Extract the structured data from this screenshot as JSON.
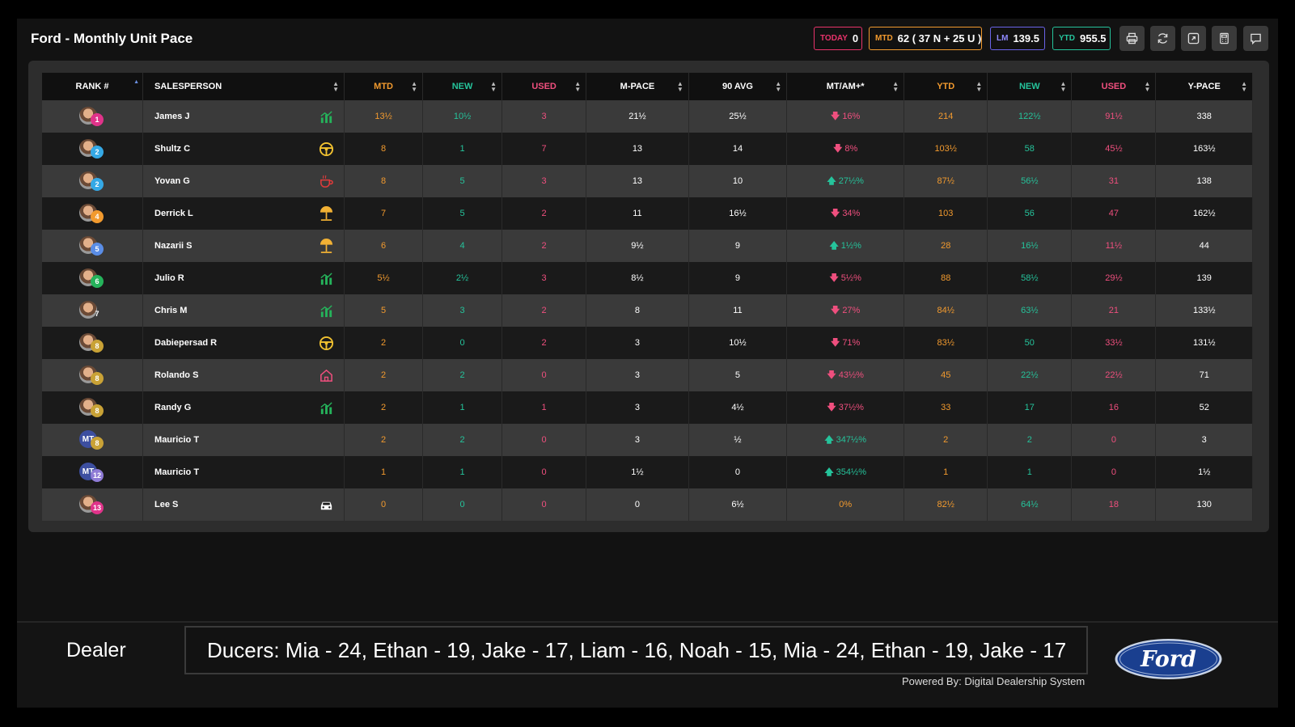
{
  "header": {
    "title": "Ford - Monthly Unit Pace",
    "stats": {
      "today": {
        "label": "TODAY",
        "value": "0"
      },
      "mtd": {
        "label": "MTD",
        "value": "62 ( 37 N + 25 U )"
      },
      "lm": {
        "label": "LM",
        "value": "139.5"
      },
      "ytd": {
        "label": "YTD",
        "value": "955.5"
      }
    },
    "tools": [
      "print-icon",
      "refresh-icon",
      "expand-icon",
      "calculator-icon",
      "chat-icon"
    ]
  },
  "colors": {
    "orange": "#f29a2e",
    "green": "#25c39b",
    "pink": "#ef4f7e",
    "today_border": "#e8336b",
    "lm_border": "#6a63e8"
  },
  "table": {
    "columns": [
      {
        "key": "rank",
        "label": "RANK #",
        "color": "white"
      },
      {
        "key": "salesperson",
        "label": "SALESPERSON",
        "color": "white"
      },
      {
        "key": "mtd",
        "label": "MTD",
        "color": "orange"
      },
      {
        "key": "new",
        "label": "NEW",
        "color": "green"
      },
      {
        "key": "used",
        "label": "USED",
        "color": "pink"
      },
      {
        "key": "mpace",
        "label": "M-PACE",
        "color": "white"
      },
      {
        "key": "avg90",
        "label": "90 AVG",
        "color": "white"
      },
      {
        "key": "mtam",
        "label": "MT/AM+*",
        "color": "white"
      },
      {
        "key": "ytd",
        "label": "YTD",
        "color": "orange"
      },
      {
        "key": "ynew",
        "label": "NEW",
        "color": "green"
      },
      {
        "key": "yused",
        "label": "USED",
        "color": "pink"
      },
      {
        "key": "ypace",
        "label": "Y-PACE",
        "color": "white"
      }
    ],
    "rows": [
      {
        "rank": "1",
        "rank_color": "#e0338a",
        "avatar": "photo",
        "name": "James J",
        "icon": "chart-bars-icon",
        "mtd": "13½",
        "new": "10½",
        "used": "3",
        "mpace": "21½",
        "avg90": "25½",
        "trend": "down",
        "mtam": "16%",
        "ytd": "214",
        "ynew": "122½",
        "yused": "91½",
        "ypace": "338"
      },
      {
        "rank": "2",
        "rank_color": "#35a9e6",
        "avatar": "photo",
        "name": "Shultz C",
        "icon": "steering-wheel-icon",
        "mtd": "8",
        "new": "1",
        "used": "7",
        "mpace": "13",
        "avg90": "14",
        "trend": "down",
        "mtam": "8%",
        "ytd": "103½",
        "ynew": "58",
        "yused": "45½",
        "ypace": "163½"
      },
      {
        "rank": "2",
        "rank_color": "#35a9e6",
        "avatar": "photo",
        "name": "Yovan G",
        "icon": "hot-beverage-icon",
        "mtd": "8",
        "new": "5",
        "used": "3",
        "mpace": "13",
        "avg90": "10",
        "trend": "up",
        "mtam": "27½%",
        "ytd": "87½",
        "ynew": "56½",
        "yused": "31",
        "ypace": "138"
      },
      {
        "rank": "4",
        "rank_color": "#f29a2e",
        "avatar": "photo",
        "name": "Derrick L",
        "icon": "beach-umbrella-icon",
        "mtd": "7",
        "new": "5",
        "used": "2",
        "mpace": "11",
        "avg90": "16½",
        "trend": "down",
        "mtam": "34%",
        "ytd": "103",
        "ynew": "56",
        "yused": "47",
        "ypace": "162½"
      },
      {
        "rank": "5",
        "rank_color": "#5a8de6",
        "avatar": "photo",
        "name": "Nazarii S",
        "icon": "beach-umbrella-icon",
        "mtd": "6",
        "new": "4",
        "used": "2",
        "mpace": "9½",
        "avg90": "9",
        "trend": "up",
        "mtam": "1½%",
        "ytd": "28",
        "ynew": "16½",
        "yused": "11½",
        "ypace": "44"
      },
      {
        "rank": "6",
        "rank_color": "#25b35b",
        "avatar": "photo",
        "name": "Julio R",
        "icon": "chart-bars-icon",
        "mtd": "5½",
        "new": "2½",
        "used": "3",
        "mpace": "8½",
        "avg90": "9",
        "trend": "down",
        "mtam": "5½%",
        "ytd": "88",
        "ynew": "58½",
        "yused": "29½",
        "ypace": "139"
      },
      {
        "rank": "7",
        "rank_color": "transparent",
        "avatar": "photo",
        "name": "Chris M",
        "icon": "chart-bars-icon",
        "mtd": "5",
        "new": "3",
        "used": "2",
        "mpace": "8",
        "avg90": "11",
        "trend": "down",
        "mtam": "27%",
        "ytd": "84½",
        "ynew": "63½",
        "yused": "21",
        "ypace": "133½"
      },
      {
        "rank": "8",
        "rank_color": "#c9a236",
        "avatar": "photo",
        "name": "Dabiepersad R",
        "icon": "steering-wheel-icon",
        "mtd": "2",
        "new": "0",
        "used": "2",
        "mpace": "3",
        "avg90": "10½",
        "trend": "down",
        "mtam": "71%",
        "ytd": "83½",
        "ynew": "50",
        "yused": "33½",
        "ypace": "131½"
      },
      {
        "rank": "8",
        "rank_color": "#c9a236",
        "avatar": "photo",
        "name": "Rolando S",
        "icon": "house-icon",
        "mtd": "2",
        "new": "2",
        "used": "0",
        "mpace": "3",
        "avg90": "5",
        "trend": "down",
        "mtam": "43½%",
        "ytd": "45",
        "ynew": "22½",
        "yused": "22½",
        "ypace": "71"
      },
      {
        "rank": "8",
        "rank_color": "#c9a236",
        "avatar": "photo",
        "name": "Randy G",
        "icon": "chart-bars-icon",
        "mtd": "2",
        "new": "1",
        "used": "1",
        "mpace": "3",
        "avg90": "4½",
        "trend": "down",
        "mtam": "37½%",
        "ytd": "33",
        "ynew": "17",
        "yused": "16",
        "ypace": "52"
      },
      {
        "rank": "8",
        "rank_color": "#c9a236",
        "avatar": "initials",
        "initials": "MT",
        "name": "Mauricio T",
        "icon": "",
        "mtd": "2",
        "new": "2",
        "used": "0",
        "mpace": "3",
        "avg90": "½",
        "trend": "up",
        "mtam": "347½%",
        "ytd": "2",
        "ynew": "2",
        "yused": "0",
        "ypace": "3"
      },
      {
        "rank": "12",
        "rank_color": "#8f7bd6",
        "avatar": "initials",
        "initials": "MT",
        "name": "Mauricio T",
        "icon": "",
        "mtd": "1",
        "new": "1",
        "used": "0",
        "mpace": "1½",
        "avg90": "0",
        "trend": "up",
        "mtam": "354½%",
        "ytd": "1",
        "ynew": "1",
        "yused": "0",
        "ypace": "1½"
      },
      {
        "rank": "13",
        "rank_color": "#e0338a",
        "avatar": "photo",
        "name": "Lee S",
        "icon": "car-icon",
        "mtd": "0",
        "new": "0",
        "used": "0",
        "mpace": "0",
        "avg90": "6½",
        "trend": "none",
        "mtam": "0%",
        "ytd": "82½",
        "ynew": "64½",
        "yused": "18",
        "ypace": "130"
      }
    ]
  },
  "footer": {
    "dealer_label": "Dealer",
    "ticker": "Ducers: Mia - 24, Ethan - 19, Jake - 17, Liam - 16, Noah - 15, Mia - 24, Ethan - 19, Jake - 17",
    "powered_by": "Powered By: Digital Dealership System",
    "logo": "Ford"
  }
}
